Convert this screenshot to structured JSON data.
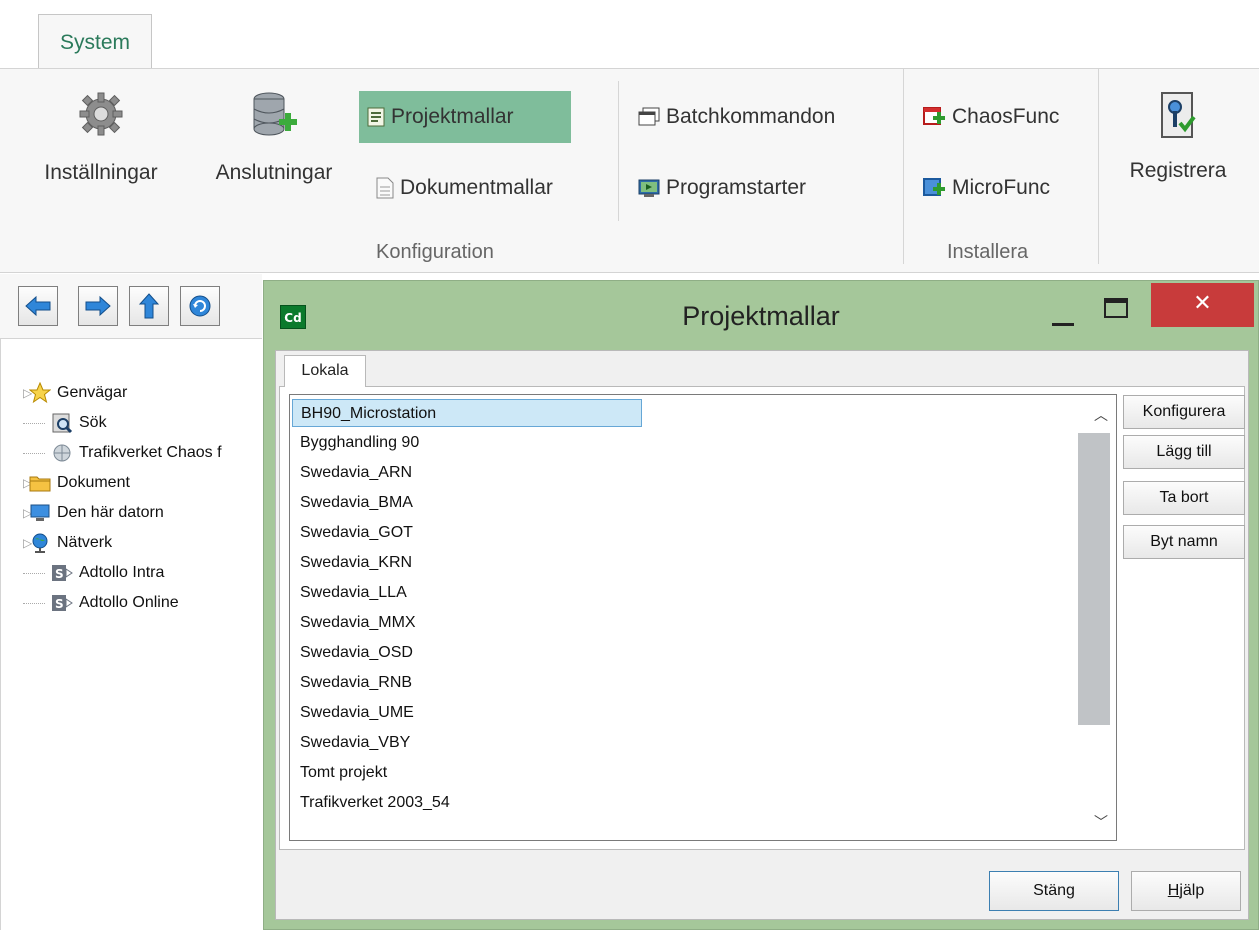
{
  "ribbon": {
    "tab_label": "System",
    "buttons": {
      "installningar": "Inställningar",
      "anslutningar": "Anslutningar",
      "projektmallar": "Projektmallar",
      "dokumentmallar": "Dokumentmallar",
      "batchkommandon": "Batchkommandon",
      "programstarter": "Programstarter",
      "chaosfunc": "ChaosFunc",
      "microfunc": "MicroFunc",
      "registrera": "Registrera"
    },
    "groups": {
      "konfiguration": "Konfiguration",
      "installera": "Installera"
    },
    "accent_color": "#7fbd9b"
  },
  "nav_toolbar": {
    "icons": [
      "back-arrow-icon",
      "forward-arrow-icon",
      "up-arrow-icon",
      "refresh-icon"
    ]
  },
  "tree": {
    "items": [
      {
        "label": "Genvägar",
        "icon": "star-icon",
        "expandable": true
      },
      {
        "label": "Sök",
        "icon": "search-icon",
        "expandable": false
      },
      {
        "label": "Trafikverket Chaos f",
        "icon": "network-share-icon",
        "expandable": false
      },
      {
        "label": "Dokument",
        "icon": "folder-icon",
        "expandable": true
      },
      {
        "label": "Den här datorn",
        "icon": "computer-icon",
        "expandable": true
      },
      {
        "label": "Nätverk",
        "icon": "globe-icon",
        "expandable": true
      },
      {
        "label": "Adtollo Intra",
        "icon": "sharepoint-icon",
        "expandable": false
      },
      {
        "label": "Adtollo Online",
        "icon": "sharepoint-icon",
        "expandable": false
      }
    ]
  },
  "dialog": {
    "title": "Projektmallar",
    "app_icon_text": "Cd",
    "tab_label": "Lokala",
    "list": {
      "selected_index": 0,
      "items": [
        "BH90_Microstation",
        "Bygghandling 90",
        "Swedavia_ARN",
        "Swedavia_BMA",
        "Swedavia_GOT",
        "Swedavia_KRN",
        "Swedavia_LLA",
        "Swedavia_MMX",
        "Swedavia_OSD",
        "Swedavia_RNB",
        "Swedavia_UME",
        "Swedavia_VBY",
        "Tomt projekt",
        "Trafikverket 2003_54"
      ]
    },
    "side_buttons": {
      "konfigurera": "Konfigurera",
      "lagg_till": "Lägg till",
      "ta_bort": "Ta bort",
      "byt_namn": "Byt namn"
    },
    "footer": {
      "stang": "Stäng",
      "hjalp_first": "H",
      "hjalp_rest": "jälp"
    },
    "close_glyph": "✕"
  }
}
